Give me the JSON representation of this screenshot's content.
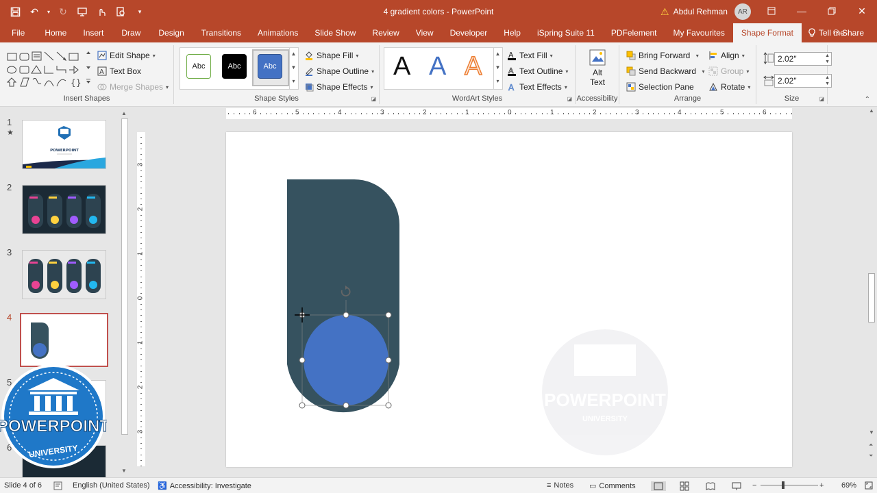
{
  "window": {
    "doc_title": "4 gradient colors  -  PowerPoint",
    "user_name": "Abdul Rehman",
    "user_initials": "AR"
  },
  "tabs": [
    "File",
    "Home",
    "Insert",
    "Draw",
    "Design",
    "Transitions",
    "Animations",
    "Slide Show",
    "Review",
    "View",
    "Developer",
    "Help",
    "iSpring Suite 11",
    "PDFelement",
    "My Favourites",
    "Shape Format"
  ],
  "active_tab": "Shape Format",
  "tell_me": "Tell me",
  "share": "Share",
  "ribbon": {
    "insert_shapes": {
      "label": "Insert Shapes",
      "edit_shape": "Edit Shape",
      "text_box": "Text Box",
      "merge_shapes": "Merge Shapes"
    },
    "shape_styles": {
      "label": "Shape Styles",
      "swatches": [
        "Abc",
        "Abc",
        "Abc"
      ],
      "shape_fill": "Shape Fill",
      "shape_outline": "Shape Outline",
      "shape_effects": "Shape Effects"
    },
    "wordart": {
      "label": "WordArt Styles",
      "letters": [
        "A",
        "A",
        "A"
      ],
      "text_fill": "Text Fill",
      "text_outline": "Text Outline",
      "text_effects": "Text Effects"
    },
    "accessibility": {
      "label": "Accessibility",
      "alt_text_1": "Alt",
      "alt_text_2": "Text"
    },
    "arrange": {
      "label": "Arrange",
      "bring_forward": "Bring Forward",
      "send_backward": "Send Backward",
      "selection_pane": "Selection Pane",
      "align": "Align",
      "group": "Group",
      "rotate": "Rotate"
    },
    "size": {
      "label": "Size",
      "height": "2.02\"",
      "width": "2.02\""
    }
  },
  "slides": {
    "numbers": [
      "1",
      "2",
      "3",
      "4",
      "5",
      "6"
    ],
    "star": "★",
    "thumb1_title": "POWERPOINT",
    "current": 4
  },
  "hruler_ticks": [
    "6",
    "5",
    "4",
    "3",
    "2",
    "1",
    "0",
    "1",
    "2",
    "3",
    "4",
    "5",
    "6"
  ],
  "vruler_ticks": [
    "3",
    "2",
    "1",
    "0",
    "1",
    "2",
    "3"
  ],
  "logo": {
    "top": "POWERPOINT",
    "bottom": "UNIVERSITY"
  },
  "watermark": {
    "top": "POWERPOINT",
    "bottom": "UNIVERSITY"
  },
  "colors": {
    "accent": "#b7472a",
    "shape_dark": "#36525f",
    "circle_blue": "#4472c4"
  },
  "status": {
    "slide_info": "Slide 4 of 6",
    "language": "English (United States)",
    "accessibility": "Accessibility: Investigate",
    "notes": "Notes",
    "comments": "Comments",
    "zoom": "69%"
  }
}
